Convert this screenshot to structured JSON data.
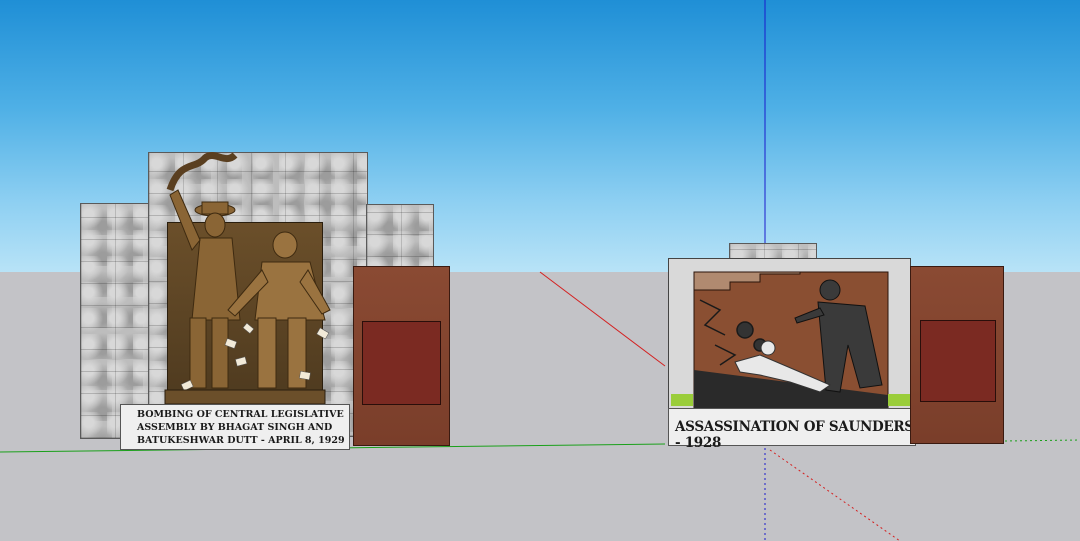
{
  "scene": {
    "sky_color": "#4fb0e6",
    "ground_color": "#c3c3c7",
    "axis_colors": {
      "red": "#d42020",
      "green": "#1aa01a",
      "blue": "#1a1acc"
    }
  },
  "monument_left": {
    "inscription_line1": "BOMBING OF CENTRAL LEGISLATIVE",
    "inscription_line2": "ASSEMBLY BY BHAGAT SINGH AND",
    "inscription_line3": "BATUKESHWAR DUTT - APRIL 8, 1929",
    "statue_color": "#7a5a30"
  },
  "monument_right": {
    "inscription": "ASSASSINATION OF SAUNDERS - 1928",
    "relief_bg_color": "#8a4f32"
  }
}
